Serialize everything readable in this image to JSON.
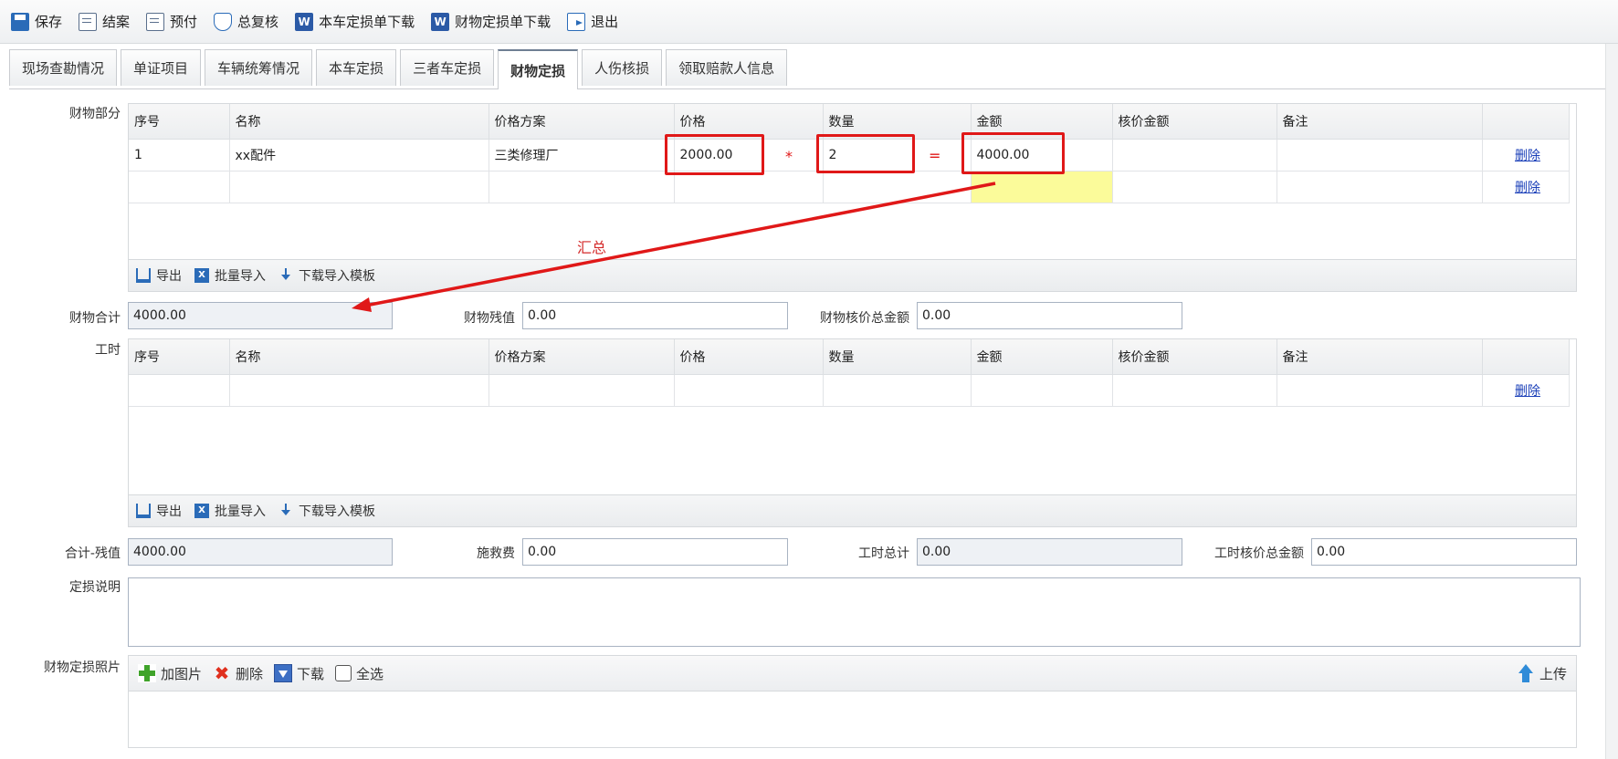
{
  "toolbar": [
    {
      "label": "保存",
      "icon": "save-icon"
    },
    {
      "label": "结案",
      "icon": "document-icon"
    },
    {
      "label": "预付",
      "icon": "document-icon"
    },
    {
      "label": "总复核",
      "icon": "shield-icon"
    },
    {
      "label": "本车定损单下载",
      "icon": "word-icon"
    },
    {
      "label": "财物定损单下载",
      "icon": "word-icon"
    },
    {
      "label": "退出",
      "icon": "exit-icon"
    }
  ],
  "tabs": [
    "现场查勘情况",
    "单证项目",
    "车辆统筹情况",
    "本车定损",
    "三者车定损",
    "财物定损",
    "人伤核损",
    "领取赔款人信息"
  ],
  "active_tab": "财物定损",
  "property_section": {
    "label": "财物部分",
    "columns": [
      "序号",
      "名称",
      "价格方案",
      "价格",
      "数量",
      "金额",
      "核价金额",
      "备注",
      ""
    ],
    "rows": [
      {
        "seq": "1",
        "name": "xx配件",
        "plan": "三类修理厂",
        "price": "2000.00",
        "qty": "2",
        "amount": "4000.00",
        "verified": "",
        "note": "",
        "delete": "删除"
      },
      {
        "seq": "",
        "name": "",
        "plan": "",
        "price": "",
        "qty": "",
        "amount": "",
        "verified": "",
        "note": "",
        "delete": "删除"
      }
    ],
    "footer": {
      "export": "导出",
      "batch_import": "批量导入",
      "download_template": "下载导入模板"
    }
  },
  "property_totals": {
    "total_label": "财物合计",
    "total_value": "4000.00",
    "residual_label": "财物残值",
    "residual_value": "0.00",
    "verified_total_label": "财物核价总金额",
    "verified_total_value": "0.00"
  },
  "labor_section": {
    "label": "工时",
    "columns": [
      "序号",
      "名称",
      "价格方案",
      "价格",
      "数量",
      "金额",
      "核价金额",
      "备注",
      ""
    ],
    "rows": [
      {
        "seq": "",
        "name": "",
        "plan": "",
        "price": "",
        "qty": "",
        "amount": "",
        "verified": "",
        "note": "",
        "delete": "删除"
      }
    ],
    "footer": {
      "export": "导出",
      "batch_import": "批量导入",
      "download_template": "下载导入模板"
    }
  },
  "summary": {
    "net_label": "合计-残值",
    "net_value": "4000.00",
    "rescue_label": "施救费",
    "rescue_value": "0.00",
    "labor_total_label": "工时总计",
    "labor_total_value": "0.00",
    "labor_verified_label": "工时核价总金额",
    "labor_verified_value": "0.00"
  },
  "assessment_note_label": "定损说明",
  "photos": {
    "label": "财物定损照片",
    "add": "加图片",
    "delete": "删除",
    "download": "下载",
    "select_all": "全选",
    "upload": "上传"
  },
  "annotations": {
    "multiply": "*",
    "equals": "=",
    "summary_text": "汇总"
  },
  "colors": {
    "annotation_red": "#e01818",
    "highlight_yellow": "#fbfb9a",
    "link_blue": "#1a3fb8"
  }
}
